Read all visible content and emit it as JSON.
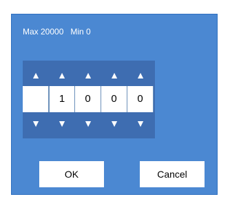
{
  "dialog": {
    "range_label": "Max 20000   Min 0",
    "spinner": {
      "up_arrow": "▲",
      "down_arrow": "▼",
      "digits": [
        "",
        "1",
        "0",
        "0",
        "0"
      ]
    },
    "ok_label": "OK",
    "cancel_label": "Cancel"
  }
}
